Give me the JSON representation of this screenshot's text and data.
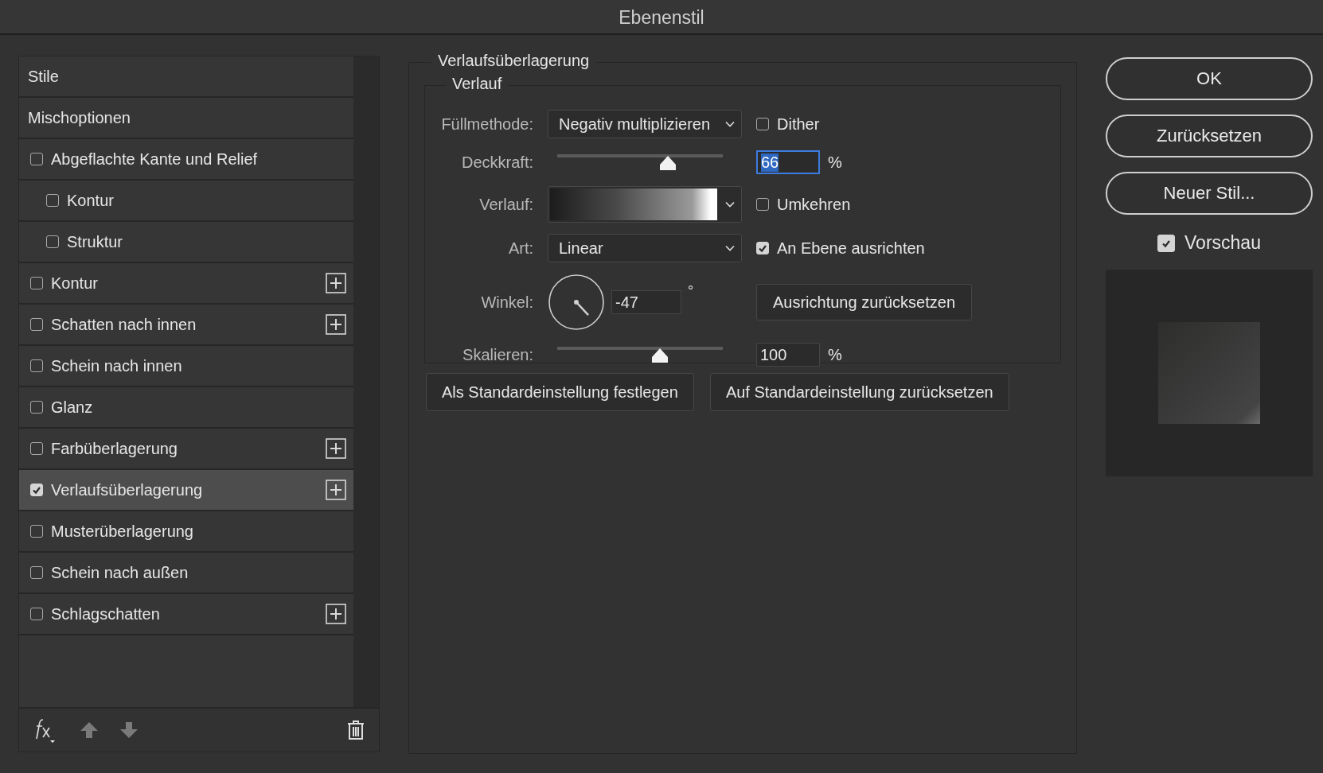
{
  "window": {
    "title": "Ebenenstil"
  },
  "styles_list": {
    "items": [
      {
        "kind": "header",
        "label": "Stile",
        "selected": false
      },
      {
        "kind": "header",
        "label": "Mischoptionen",
        "selected": false
      },
      {
        "kind": "checkbox",
        "label": "Abgeflachte Kante und Relief",
        "checked": false,
        "selected": false,
        "add_button": false,
        "children": [
          {
            "kind": "checkbox",
            "label": "Kontur",
            "checked": false,
            "selected": false,
            "add_button": false
          },
          {
            "kind": "checkbox",
            "label": "Struktur",
            "checked": false,
            "selected": false,
            "add_button": false
          }
        ]
      },
      {
        "kind": "checkbox",
        "label": "Kontur",
        "checked": false,
        "selected": false,
        "add_button": true
      },
      {
        "kind": "checkbox",
        "label": "Schatten nach innen",
        "checked": false,
        "selected": false,
        "add_button": true
      },
      {
        "kind": "checkbox",
        "label": "Schein nach innen",
        "checked": false,
        "selected": false,
        "add_button": false
      },
      {
        "kind": "checkbox",
        "label": "Glanz",
        "checked": false,
        "selected": false,
        "add_button": false
      },
      {
        "kind": "checkbox",
        "label": "Farbüberlagerung",
        "checked": false,
        "selected": false,
        "add_button": true
      },
      {
        "kind": "checkbox",
        "label": "Verlaufsüberlagerung",
        "checked": true,
        "selected": true,
        "add_button": true
      },
      {
        "kind": "checkbox",
        "label": "Musterüberlagerung",
        "checked": false,
        "selected": false,
        "add_button": false
      },
      {
        "kind": "checkbox",
        "label": "Schein nach außen",
        "checked": false,
        "selected": false,
        "add_button": false
      },
      {
        "kind": "checkbox",
        "label": "Schlagschatten",
        "checked": false,
        "selected": false,
        "add_button": true
      }
    ]
  },
  "gradient_overlay": {
    "title": "Verlaufsüberlagerung",
    "group_title": "Verlauf",
    "blend_mode": {
      "label": "Füllmethode:",
      "value": "Negativ multiplizieren"
    },
    "dither": {
      "label": "Dither",
      "checked": false
    },
    "opacity": {
      "label": "Deckkraft:",
      "level": 0.67,
      "value": "66",
      "unit": "%"
    },
    "gradient": {
      "label": "Verlauf:"
    },
    "reverse": {
      "label": "Umkehren",
      "checked": false
    },
    "style": {
      "label": "Art:",
      "value": "Linear"
    },
    "align": {
      "label": "An Ebene ausrichten",
      "checked": true
    },
    "angle": {
      "label": "Winkel:",
      "value": "-47",
      "unit": "°"
    },
    "reset_alignment": "Ausrichtung zurücksetzen",
    "scale": {
      "label": "Skalieren:",
      "level": 0.62,
      "value": "100",
      "unit": "%"
    },
    "buttons": [
      "Als Standardeinstellung festlegen",
      "Auf Standardeinstellung zurücksetzen"
    ]
  },
  "actions": {
    "buttons": [
      "OK",
      "Zurücksetzen",
      "Neuer Stil..."
    ],
    "preview": {
      "label": "Vorschau",
      "checked": true
    }
  }
}
